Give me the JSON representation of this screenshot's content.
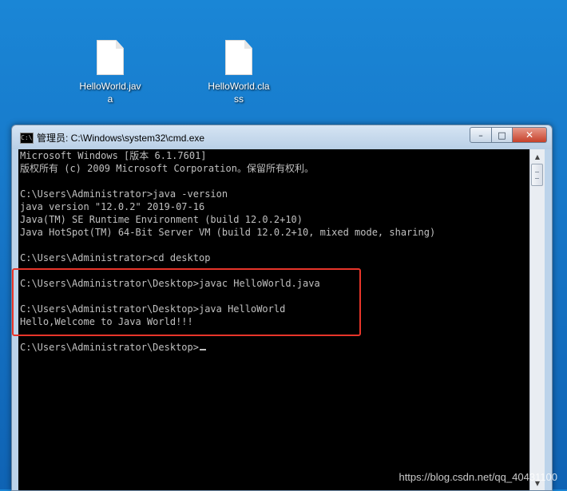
{
  "desktop": {
    "icons": [
      {
        "label": "HelloWorld.java"
      },
      {
        "label": "HelloWorld.class"
      }
    ]
  },
  "window": {
    "title": "管理员: C:\\Windows\\system32\\cmd.exe",
    "icon_text": "C:\\",
    "buttons": {
      "minimize": "–",
      "maximize": "□",
      "close": "✕"
    }
  },
  "console": {
    "lines": [
      "Microsoft Windows [版本 6.1.7601]",
      "版权所有 (c) 2009 Microsoft Corporation。保留所有权利。",
      "",
      "C:\\Users\\Administrator>java -version",
      "java version \"12.0.2\" 2019-07-16",
      "Java(TM) SE Runtime Environment (build 12.0.2+10)",
      "Java HotSpot(TM) 64-Bit Server VM (build 12.0.2+10, mixed mode, sharing)",
      "",
      "C:\\Users\\Administrator>cd desktop",
      "",
      "C:\\Users\\Administrator\\Desktop>javac HelloWorld.java",
      "",
      "C:\\Users\\Administrator\\Desktop>java HelloWorld",
      "Hello,Welcome to Java World!!!",
      "",
      "C:\\Users\\Administrator\\Desktop>"
    ]
  },
  "scrollbar": {
    "up_icon": "▲",
    "down_icon": "▼"
  },
  "watermark": "https://blog.csdn.net/qq_40431100",
  "colors": {
    "highlight": "#e8352a",
    "console_bg": "#000000",
    "console_fg": "#c0c0c0"
  }
}
